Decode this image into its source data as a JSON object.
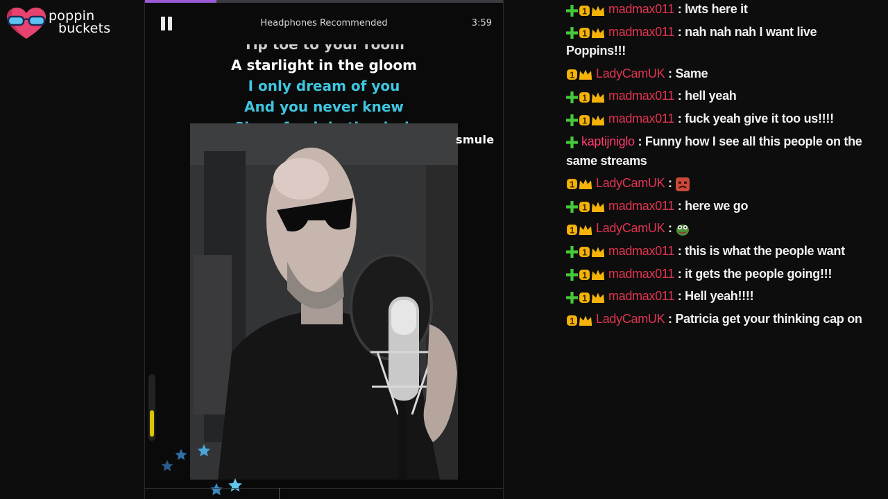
{
  "logo": {
    "line1": "poppin",
    "line2": "buckets"
  },
  "player": {
    "progress": 0.2,
    "headphones_text": "Headphones Recommended",
    "duration": "3:59",
    "lyrics": {
      "prev": "Tip toe to your room",
      "current": "A starlight in the gloom",
      "next1": "I only dream of you",
      "next2": "And you never knew",
      "next3": "Sleep fresh in the dark"
    },
    "watermark": "smule",
    "mic_level": 0.45
  },
  "colors": {
    "accent_purple": "#9b59d6",
    "lyric_active": "#3fc6df",
    "username_red": "#e2344f",
    "username_pink": "#ff3b6b",
    "sub_green": "#45c83a",
    "badge_gold": "#f5b30a"
  },
  "chat": {
    "messages": [
      {
        "user": "madmax011",
        "text": "lwts here it",
        "badges": [
          "sub-plus-icon",
          "one-badge-icon",
          "crown-icon"
        ]
      },
      {
        "user": "madmax011",
        "text": "nah nah nah I want live",
        "text2": "Poppins!!!",
        "badges": [
          "sub-plus-icon",
          "one-badge-icon",
          "crown-icon"
        ]
      },
      {
        "user": "LadyCamUK",
        "text": "Same",
        "badges": [
          "one-badge-icon",
          "crown-icon"
        ]
      },
      {
        "user": "madmax011",
        "text": "hell yeah",
        "badges": [
          "sub-plus-icon",
          "one-badge-icon",
          "crown-icon"
        ]
      },
      {
        "user": "madmax011",
        "text": "fuck yeah give it too us!!!!",
        "badges": [
          "sub-plus-icon",
          "one-badge-icon",
          "crown-icon"
        ]
      },
      {
        "user": "kaptijniglo",
        "text": "Funny how I see all this people on the",
        "text2": "same streams",
        "badges": [
          "sub-plus-icon"
        ]
      },
      {
        "user": "LadyCamUK",
        "text": "",
        "emote": "angry-face-emote",
        "badges": [
          "one-badge-icon",
          "crown-icon"
        ]
      },
      {
        "user": "madmax011",
        "text": "here we go",
        "badges": [
          "sub-plus-icon",
          "one-badge-icon",
          "crown-icon"
        ]
      },
      {
        "user": "LadyCamUK",
        "text": "",
        "emote": "pepe-emote",
        "badges": [
          "one-badge-icon",
          "crown-icon"
        ]
      },
      {
        "user": "madmax011",
        "text": "this is what the people want",
        "badges": [
          "sub-plus-icon",
          "one-badge-icon",
          "crown-icon"
        ]
      },
      {
        "user": "madmax011",
        "text": "it gets the people going!!!",
        "badges": [
          "sub-plus-icon",
          "one-badge-icon",
          "crown-icon"
        ]
      },
      {
        "user": "madmax011",
        "text": "Hell yeah!!!!",
        "badges": [
          "sub-plus-icon",
          "one-badge-icon",
          "crown-icon"
        ]
      },
      {
        "user": "LadyCamUK",
        "text": "Patricia get your thinking cap on",
        "badges": [
          "one-badge-icon",
          "crown-icon"
        ]
      }
    ]
  }
}
